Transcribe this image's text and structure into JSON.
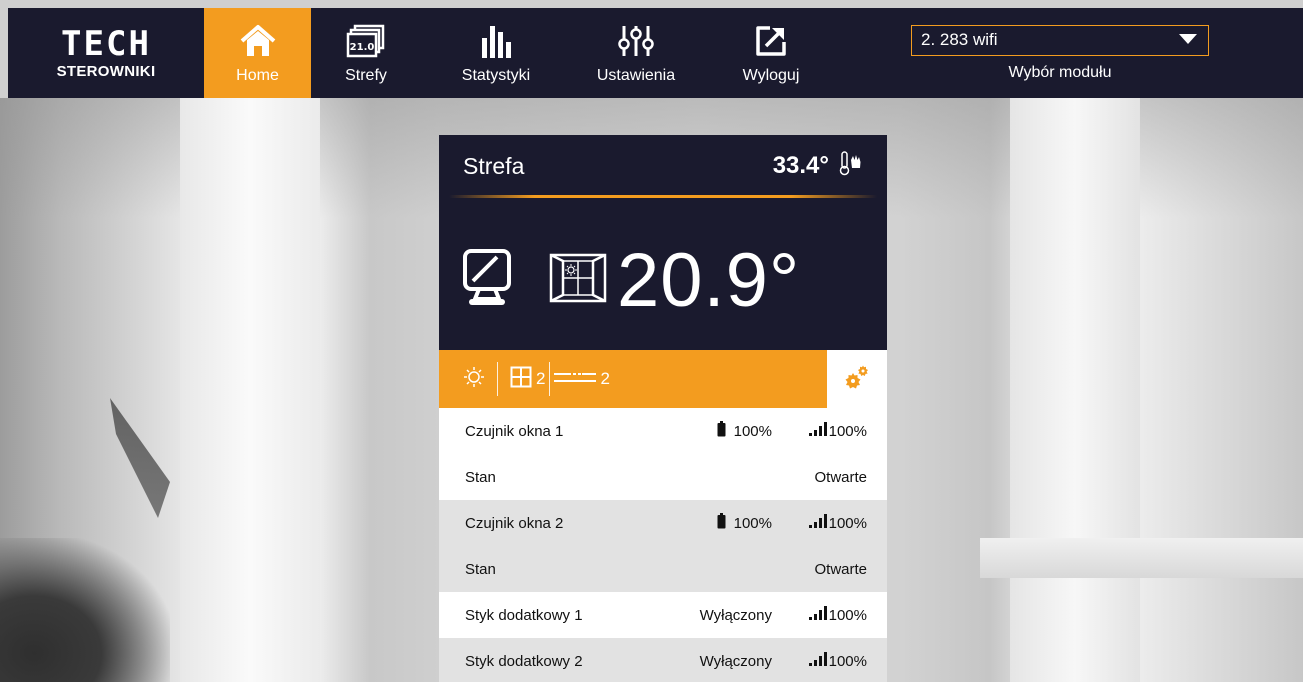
{
  "brand": {
    "mark": "TECH",
    "subtitle": "STEROWNIKI"
  },
  "nav": [
    {
      "label": "Home",
      "icon": "house-icon",
      "active": true
    },
    {
      "label": "Strefy",
      "icon": "zones-icon",
      "badge": "21.0"
    },
    {
      "label": "Statystyki",
      "icon": "statistics-icon"
    },
    {
      "label": "Ustawienia",
      "icon": "sliders-icon"
    },
    {
      "label": "Wyloguj",
      "icon": "logout-icon"
    }
  ],
  "module": {
    "selected": "2. 283 wifi",
    "label": "Wybór modułu"
  },
  "zone": {
    "name": "Strefa",
    "current_temp": "33.4°",
    "main_temp": "20.9°",
    "window_count": "2",
    "contact_count": "2"
  },
  "rows": [
    {
      "label": "Czujnik okna 1",
      "battery": "100%",
      "signal": "100%"
    },
    {
      "label": "Stan",
      "value": "Otwarte"
    },
    {
      "label": "Czujnik okna 2",
      "battery": "100%",
      "signal": "100%"
    },
    {
      "label": "Stan",
      "value": "Otwarte"
    },
    {
      "label": "Styk dodatkowy 1",
      "state": "Wyłączony",
      "signal": "100%"
    },
    {
      "label": "Styk dodatkowy 2",
      "state": "Wyłączony",
      "signal": "100%"
    }
  ],
  "colors": {
    "accent": "#f39c1f",
    "dark": "#1a1a2e",
    "row_grey": "#e2e2e2"
  }
}
